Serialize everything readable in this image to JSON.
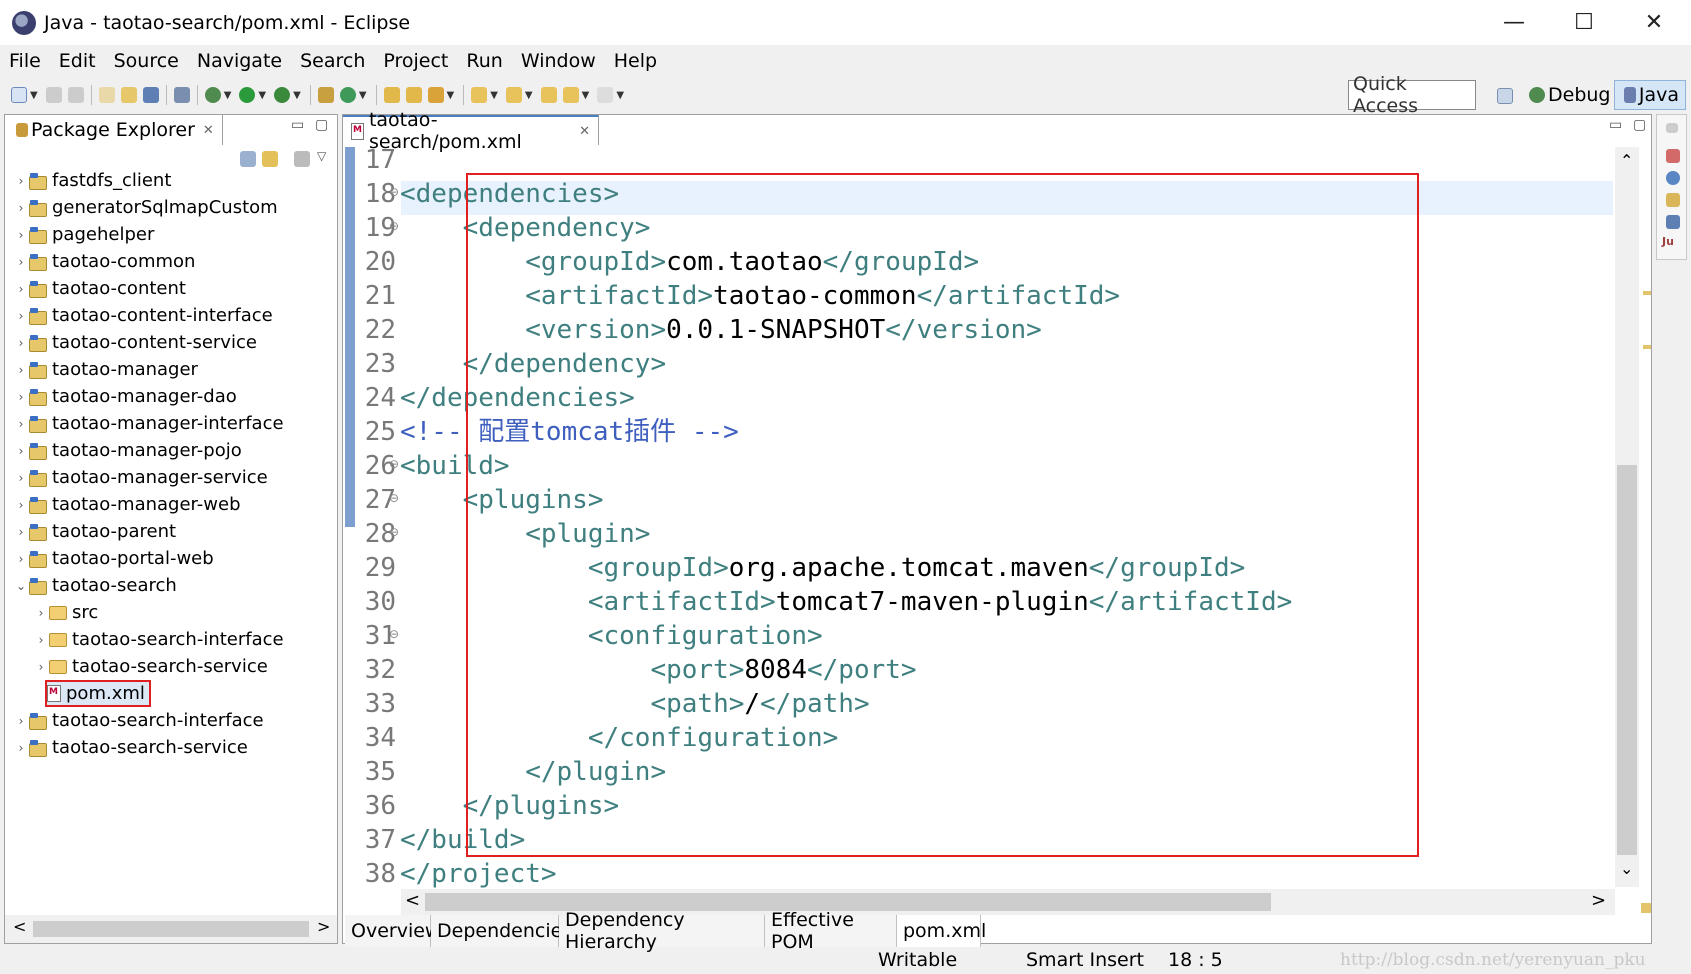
{
  "window": {
    "title": "Java - taotao-search/pom.xml - Eclipse",
    "controls": [
      "—",
      "☐",
      "✕"
    ]
  },
  "menu": [
    "File",
    "Edit",
    "Source",
    "Navigate",
    "Search",
    "Project",
    "Run",
    "Window",
    "Help"
  ],
  "toolbar": {
    "quick_access": "Quick Access",
    "perspectives": [
      "Debug",
      "Java"
    ]
  },
  "package_explorer": {
    "title": "Package Explorer",
    "items": [
      {
        "label": "fastdfs_client",
        "type": "project",
        "level": 0,
        "expanded": false
      },
      {
        "label": "generatorSqlmapCustom",
        "type": "project",
        "level": 0,
        "expanded": false
      },
      {
        "label": "pagehelper",
        "type": "project",
        "level": 0,
        "expanded": false
      },
      {
        "label": "taotao-common",
        "type": "project",
        "level": 0,
        "expanded": false
      },
      {
        "label": "taotao-content",
        "type": "project",
        "level": 0,
        "expanded": false
      },
      {
        "label": "taotao-content-interface",
        "type": "project",
        "level": 0,
        "expanded": false
      },
      {
        "label": "taotao-content-service",
        "type": "project",
        "level": 0,
        "expanded": false
      },
      {
        "label": "taotao-manager",
        "type": "project",
        "level": 0,
        "expanded": false
      },
      {
        "label": "taotao-manager-dao",
        "type": "project",
        "level": 0,
        "expanded": false
      },
      {
        "label": "taotao-manager-interface",
        "type": "project",
        "level": 0,
        "expanded": false
      },
      {
        "label": "taotao-manager-pojo",
        "type": "project",
        "level": 0,
        "expanded": false
      },
      {
        "label": "taotao-manager-service",
        "type": "project",
        "level": 0,
        "expanded": false
      },
      {
        "label": "taotao-manager-web",
        "type": "project",
        "level": 0,
        "expanded": false
      },
      {
        "label": "taotao-parent",
        "type": "project",
        "level": 0,
        "expanded": false
      },
      {
        "label": "taotao-portal-web",
        "type": "project",
        "level": 0,
        "expanded": false
      },
      {
        "label": "taotao-search",
        "type": "project",
        "level": 0,
        "expanded": true
      },
      {
        "label": "src",
        "type": "folder",
        "level": 1,
        "expanded": false
      },
      {
        "label": "taotao-search-interface",
        "type": "folder",
        "level": 1,
        "expanded": false
      },
      {
        "label": "taotao-search-service",
        "type": "folder",
        "level": 1,
        "expanded": false
      },
      {
        "label": "pom.xml",
        "type": "file",
        "level": 1,
        "selected": true
      },
      {
        "label": "taotao-search-interface",
        "type": "project",
        "level": 0,
        "expanded": false
      },
      {
        "label": "taotao-search-service",
        "type": "project",
        "level": 0,
        "expanded": false
      }
    ]
  },
  "editor": {
    "tab": "taotao-search/pom.xml",
    "lines": [
      {
        "n": "17",
        "fold": false,
        "parts": []
      },
      {
        "n": "18",
        "fold": true,
        "parts": [
          {
            "c": "tag",
            "t": "<dependencies>"
          }
        ]
      },
      {
        "n": "19",
        "fold": true,
        "parts": [
          {
            "c": "tag",
            "t": "    <dependency>"
          }
        ]
      },
      {
        "n": "20",
        "fold": false,
        "parts": [
          {
            "c": "tag",
            "t": "        <groupId>"
          },
          {
            "c": "txt",
            "t": "com.taotao"
          },
          {
            "c": "tag",
            "t": "</groupId>"
          }
        ]
      },
      {
        "n": "21",
        "fold": false,
        "parts": [
          {
            "c": "tag",
            "t": "        <artifactId>"
          },
          {
            "c": "txt",
            "t": "taotao-common"
          },
          {
            "c": "tag",
            "t": "</artifactId>"
          }
        ]
      },
      {
        "n": "22",
        "fold": false,
        "parts": [
          {
            "c": "tag",
            "t": "        <version>"
          },
          {
            "c": "txt",
            "t": "0.0.1-SNAPSHOT"
          },
          {
            "c": "tag",
            "t": "</version>"
          }
        ]
      },
      {
        "n": "23",
        "fold": false,
        "parts": [
          {
            "c": "tag",
            "t": "    </dependency>"
          }
        ]
      },
      {
        "n": "24",
        "fold": false,
        "parts": [
          {
            "c": "tag",
            "t": "</dependencies>"
          }
        ]
      },
      {
        "n": "25",
        "fold": false,
        "parts": [
          {
            "c": "cmt",
            "t": "<!-- 配置tomcat插件 -->"
          }
        ]
      },
      {
        "n": "26",
        "fold": true,
        "parts": [
          {
            "c": "tag",
            "t": "<build>"
          }
        ]
      },
      {
        "n": "27",
        "fold": true,
        "parts": [
          {
            "c": "tag",
            "t": "    <plugins>"
          }
        ]
      },
      {
        "n": "28",
        "fold": true,
        "parts": [
          {
            "c": "tag",
            "t": "        <plugin>"
          }
        ]
      },
      {
        "n": "29",
        "fold": false,
        "parts": [
          {
            "c": "tag",
            "t": "            <groupId>"
          },
          {
            "c": "txt",
            "t": "org.apache.tomcat.maven"
          },
          {
            "c": "tag",
            "t": "</groupId>"
          }
        ]
      },
      {
        "n": "30",
        "fold": false,
        "parts": [
          {
            "c": "tag",
            "t": "            <artifactId>"
          },
          {
            "c": "txt",
            "t": "tomcat7-maven-plugin"
          },
          {
            "c": "tag",
            "t": "</artifactId>"
          }
        ]
      },
      {
        "n": "31",
        "fold": true,
        "parts": [
          {
            "c": "tag",
            "t": "            <configuration>"
          }
        ]
      },
      {
        "n": "32",
        "fold": false,
        "parts": [
          {
            "c": "tag",
            "t": "                <port>"
          },
          {
            "c": "txt",
            "t": "8084"
          },
          {
            "c": "tag",
            "t": "</port>"
          }
        ]
      },
      {
        "n": "33",
        "fold": false,
        "parts": [
          {
            "c": "tag",
            "t": "                <path>"
          },
          {
            "c": "txt",
            "t": "/"
          },
          {
            "c": "tag",
            "t": "</path>"
          }
        ]
      },
      {
        "n": "34",
        "fold": false,
        "parts": [
          {
            "c": "tag",
            "t": "            </configuration>"
          }
        ]
      },
      {
        "n": "35",
        "fold": false,
        "parts": [
          {
            "c": "tag",
            "t": "        </plugin>"
          }
        ]
      },
      {
        "n": "36",
        "fold": false,
        "parts": [
          {
            "c": "tag",
            "t": "    </plugins>"
          }
        ]
      },
      {
        "n": "37",
        "fold": false,
        "parts": [
          {
            "c": "tag",
            "t": "</build>"
          }
        ]
      },
      {
        "n": "38",
        "fold": false,
        "parts": [
          {
            "c": "tag",
            "t": "</project>"
          }
        ]
      }
    ],
    "bottom_tabs": [
      "Overview",
      "Dependencies",
      "Dependency Hierarchy",
      "Effective POM",
      "pom.xml"
    ],
    "active_bottom_tab": "pom.xml"
  },
  "status_bar": {
    "mode": "Writable",
    "insert": "Smart Insert",
    "position": "18 : 5",
    "watermark": "http://blog.csdn.net/yerenyuan_pku"
  },
  "colors": {
    "tag": "#3f7f7f",
    "comment": "#3f5fbf",
    "highlight_box": "#e02020",
    "current_line": "#e8f2fe"
  }
}
